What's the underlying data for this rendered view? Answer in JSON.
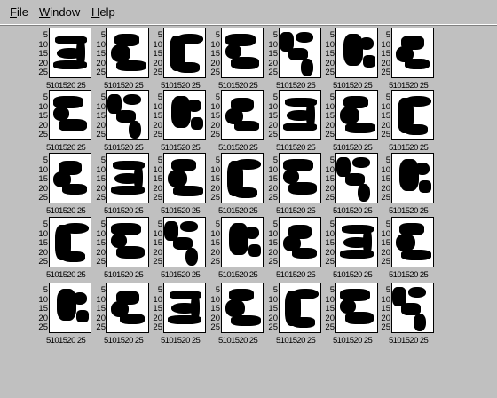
{
  "menubar": {
    "items": [
      {
        "label": "File",
        "ul": "F",
        "rest": "ile"
      },
      {
        "label": "Window",
        "ul": "W",
        "rest": "indow"
      },
      {
        "label": "Help",
        "ul": "H",
        "rest": "elp"
      }
    ]
  },
  "figure": {
    "rows": 5,
    "cols": 7,
    "y_ticks": [
      "5",
      "10",
      "15",
      "20",
      "25"
    ],
    "x_tick_text": "5101520 25",
    "cell_color": "#ffffff",
    "ink_color": "#000000"
  }
}
